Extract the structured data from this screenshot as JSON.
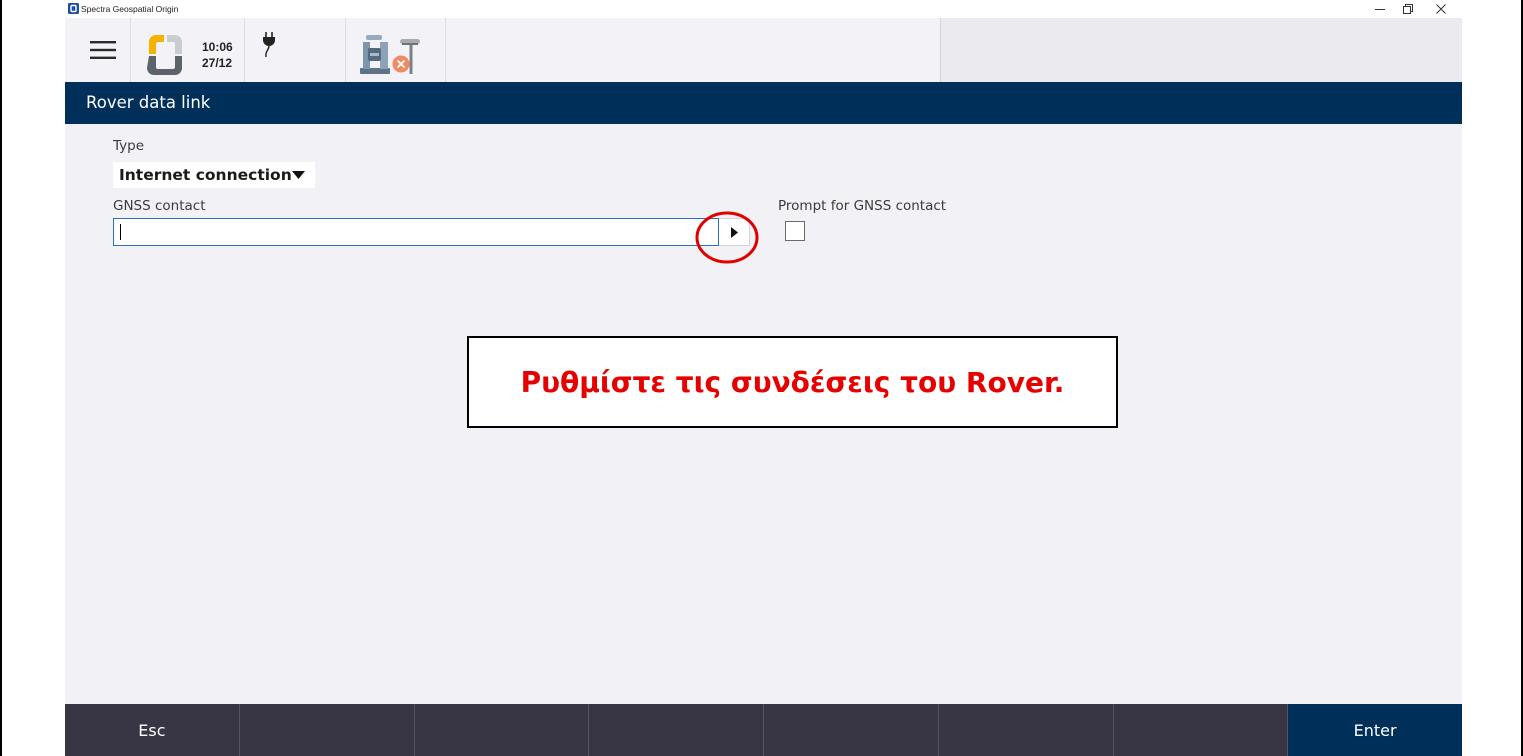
{
  "window": {
    "title": "Spectra Geospatial Origin",
    "icons": {
      "app": "app-icon",
      "minimize": "minimize-icon",
      "restore": "restore-icon",
      "close": "close-icon"
    }
  },
  "toolbar": {
    "time": "10:06",
    "date": "27/12",
    "icons": {
      "menu": "hamburger-icon",
      "job": "job-icon",
      "power": "plug-icon",
      "instrument": "instrument-icon",
      "instrument_status": "disconnected-x-icon"
    }
  },
  "header": {
    "title": "Rover data link"
  },
  "form": {
    "type": {
      "label": "Type",
      "value": "Internet connection"
    },
    "gnss_contact": {
      "label": "GNSS contact",
      "value": ""
    },
    "prompt_gnss_contact": {
      "label": "Prompt for GNSS contact",
      "checked": false
    }
  },
  "annotation": {
    "text": "Ρυθμίστε τις συνδέσεις του Rover."
  },
  "softkeys": [
    "Esc",
    "",
    "",
    "",
    "",
    "",
    "",
    "Enter"
  ],
  "colors": {
    "header_bg": "#00305a",
    "enter_bg": "#00305a",
    "softkey_bg": "#383644",
    "page_bg": "#f1f1f6",
    "annotation_text": "#e60000",
    "highlight_circle": "#e00000",
    "input_border": "#2d6fb8"
  }
}
